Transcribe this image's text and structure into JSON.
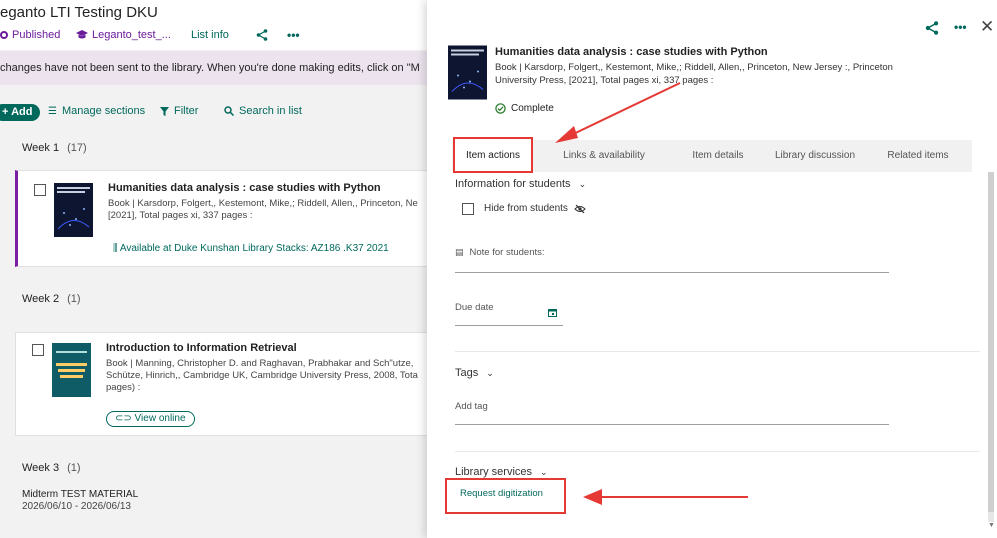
{
  "app": {
    "title": "eganto LTI Testing DKU",
    "status": "Published",
    "course": "Leganto_test_...",
    "list_info": "List info"
  },
  "banner": {
    "text": "changes have not been sent to the library. When you're done making edits, click on \"M"
  },
  "toolbar": {
    "add": "+ Add",
    "manage_sections": "Manage sections",
    "filter": "Filter",
    "search": "Search in list"
  },
  "weeks": [
    {
      "label": "Week 1",
      "count": "(17)"
    },
    {
      "label": "Week 2",
      "count": "(1)"
    },
    {
      "label": "Week 3",
      "count": "(1)"
    }
  ],
  "items": [
    {
      "title": "Humanities data analysis : case studies with Python",
      "line1": "Book  |  Karsdorp, Folgert,, Kestemont, Mike,; Riddell, Allen,, Princeton, Ne",
      "line2": "[2021], Total pages xi, 337 pages :",
      "availability": "Available at Duke Kunshan Library Stacks: AZ186 .K37 2021"
    },
    {
      "title": "Introduction to Information Retrieval",
      "line1": "Book  |  Manning, Christopher D. and Raghavan, Prabhakar and Sch\"utze,",
      "line2": "Schütze, Hinrich,, Cambridge UK, Cambridge University Press, 2008, Tota",
      "line3": "pages) :",
      "view_online": "View online"
    }
  ],
  "week3_item": {
    "title": "Midterm TEST MATERIAL",
    "dates": "2026/06/10 - 2026/06/13"
  },
  "panel": {
    "title": "Humanities data analysis : case studies with Python",
    "line1": "Book  |  Karsdorp, Folgert,, Kestemont, Mike,; Riddell, Allen,, Princeton, New Jersey :, Princeton",
    "line2": "University Press, [2021], Total pages xi, 337 pages :",
    "status": "Complete",
    "tabs": [
      "Item actions",
      "Links & availability",
      "Item details",
      "Library discussion",
      "Related items"
    ],
    "info_students": "Information for students",
    "hide_students": "Hide from students",
    "note_students": "Note for students:",
    "due_date": "Due date",
    "tags": "Tags",
    "add_tag": "Add tag",
    "library_services": "Library services",
    "request_digitization": "Request digitization"
  },
  "colors": {
    "accent": "#00695c",
    "publish": "#6a1b9a",
    "annotation_red": "#e53935",
    "banner_bg": "#ece3ee"
  }
}
